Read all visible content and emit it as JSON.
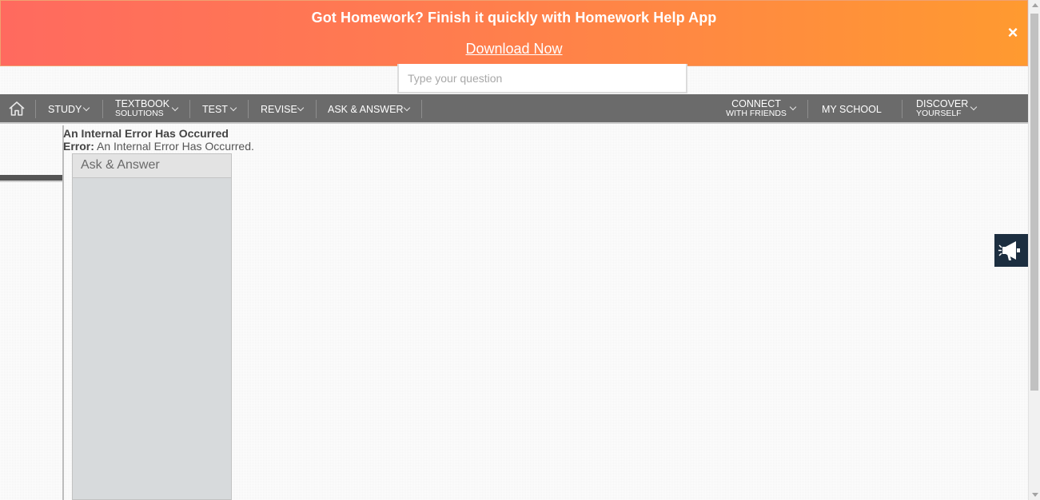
{
  "promo": {
    "title": "Got Homework? Finish it quickly with Homework Help App",
    "link": "Download Now",
    "close": "×"
  },
  "search": {
    "placeholder": "Type your question"
  },
  "nav": {
    "home_icon": "home-icon",
    "study": "STUDY",
    "textbook_l1": "TEXTBOOK",
    "textbook_l2": "SOLUTIONS",
    "test": "TEST",
    "revise": "REVISE",
    "ask_answer": "ASK & ANSWER",
    "connect_l1": "CONNECT",
    "connect_l2": "WITH FRIENDS",
    "my_school": "MY SCHOOL",
    "discover_l1": "DISCOVER",
    "discover_l2": "YOURSELF"
  },
  "error": {
    "title": "An Internal Error Has Occurred",
    "label": "Error:",
    "message": "An Internal Error Has Occurred."
  },
  "panel": {
    "title": "Ask & Answer"
  },
  "feedback": {
    "icon": "megaphone-icon"
  },
  "colors": {
    "promo_start": "#ff6a5f",
    "promo_end": "#ff9a30",
    "nav_bg": "#6b6b6b",
    "feedback_bg": "#1c2e40"
  }
}
